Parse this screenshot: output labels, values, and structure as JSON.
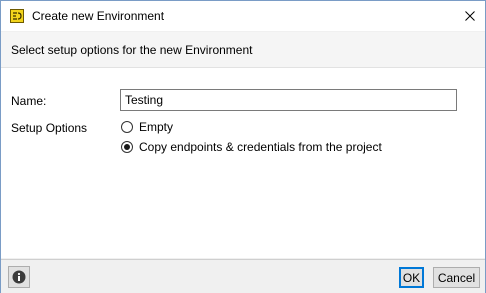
{
  "window": {
    "title": "Create new Environment",
    "icon": "environment-app-icon",
    "close_icon": "close-icon"
  },
  "header": {
    "text": "Select setup options for the new Environment"
  },
  "form": {
    "name_label": "Name:",
    "name_value": "Testing",
    "setup_label": "Setup Options",
    "options": [
      {
        "label": "Empty",
        "selected": false
      },
      {
        "label": "Copy endpoints & credentials from the project",
        "selected": true
      }
    ]
  },
  "footer": {
    "info_icon": "info-icon",
    "ok_label": "OK",
    "cancel_label": "Cancel"
  },
  "colors": {
    "accent": "#0078d7",
    "app_icon": "#f2d41c"
  }
}
